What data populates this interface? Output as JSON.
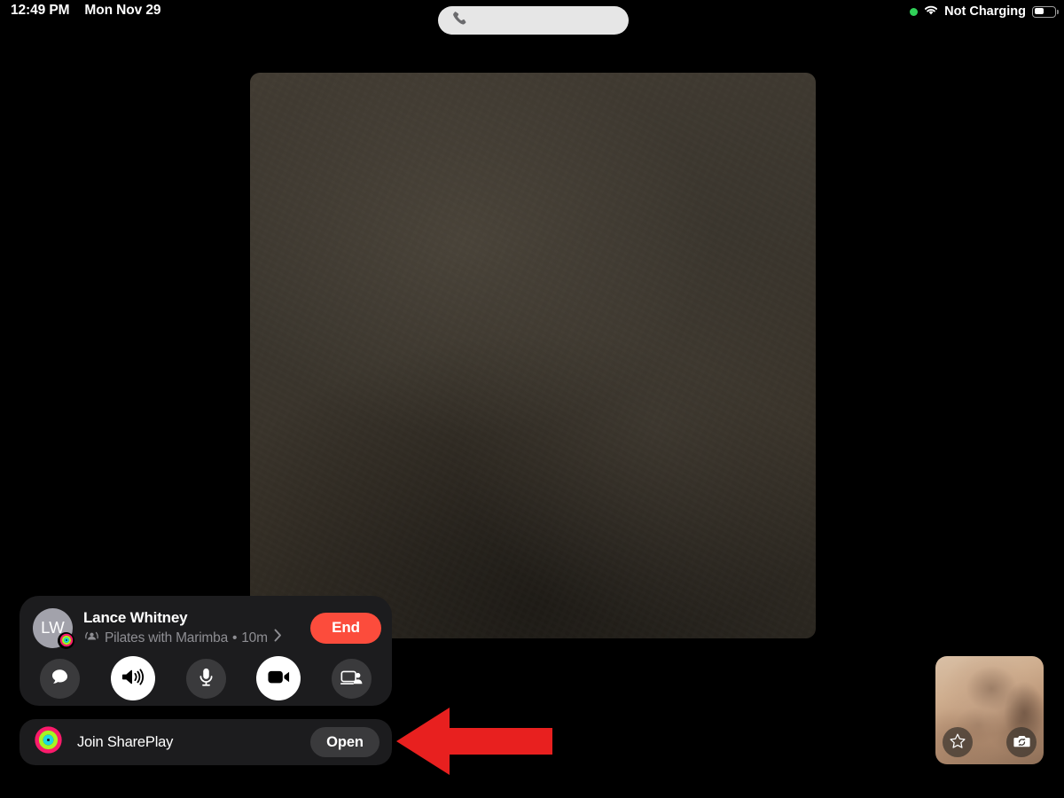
{
  "status_bar": {
    "time": "12:49 PM",
    "date": "Mon Nov 29",
    "recording_indicator": "green-dot",
    "wifi_icon": "wifi-icon",
    "battery_label": "Not Charging",
    "battery_icon": "battery-icon",
    "battery_level_pct": 42
  },
  "call_pill": {
    "icon": "phone-handset-icon",
    "label": ""
  },
  "video_stage": {
    "description": "remote participant video, very dark",
    "background_color": "#3a352e"
  },
  "call_card": {
    "avatar_initials": "LW",
    "avatar_badge_icon": "activity-rings-icon",
    "caller_name": "Lance Whitney",
    "shareplay_icon": "shareplay-icon",
    "activity_subtitle": "Pilates with Marimba",
    "separator": "•",
    "duration": "10m",
    "disclosure_icon": "chevron-right-icon",
    "end_label": "End",
    "end_color": "#fc4c3c",
    "controls": [
      {
        "name": "messages-button",
        "icon": "chat-bubble-icon",
        "active": false
      },
      {
        "name": "speaker-button",
        "icon": "speaker-waves-icon",
        "active": true
      },
      {
        "name": "mute-button",
        "icon": "microphone-icon",
        "active": false
      },
      {
        "name": "camera-button",
        "icon": "video-camera-icon",
        "active": true
      },
      {
        "name": "share-screen-button",
        "icon": "share-screen-person-icon",
        "active": false
      }
    ]
  },
  "shareplay_banner": {
    "icon": "activity-rings-icon",
    "label": "Join SharePlay",
    "open_label": "Open"
  },
  "pip": {
    "label": "self-view",
    "effects_icon": "star-effects-icon",
    "flip_camera_icon": "flip-camera-icon"
  },
  "annotation": {
    "type": "arrow",
    "direction": "left",
    "color": "#e8201f",
    "points_at": "Open button in Join SharePlay banner"
  },
  "colors": {
    "background": "#000000",
    "card": "#1c1c1e",
    "control_off": "#3a3a3c",
    "control_on": "#ffffff",
    "accent_red": "#fc4c3c",
    "annotation_red": "#e8201f",
    "secondary_text": "#8e8e93",
    "green_status": "#30d158"
  }
}
